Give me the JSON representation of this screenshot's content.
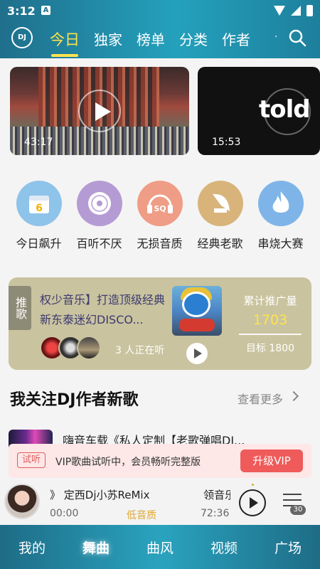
{
  "status": {
    "time": "3:12",
    "notif_glyph": "A"
  },
  "header": {
    "logo": "DJ",
    "tabs": [
      "今日",
      "独家",
      "榜单",
      "分类",
      "作者"
    ],
    "active_tab": "今日",
    "overflow": "·"
  },
  "videos": [
    {
      "duration": "43:17"
    },
    {
      "duration": "15:53",
      "text": "told"
    }
  ],
  "categories": [
    {
      "label": "今日飙升",
      "icon": "calendar-icon",
      "color": "#8ec3ea",
      "glyph": "6"
    },
    {
      "label": "百听不厌",
      "icon": "disc-icon",
      "color": "#b59bd3",
      "glyph": "◉"
    },
    {
      "label": "无损音质",
      "icon": "headphones-sq-icon",
      "color": "#ef9d86",
      "glyph": "SQ"
    },
    {
      "label": "经典老歌",
      "icon": "gramophone-icon",
      "color": "#d8b47a",
      "glyph": "♫"
    },
    {
      "label": "串烧大赛",
      "icon": "flame-icon",
      "color": "#7fb4e8",
      "glyph": "♨"
    }
  ],
  "recommend": {
    "badge": "推歌",
    "title": "权少音乐】打造顶级经典新东泰迷幻DISCO...",
    "listeners": "3 人正在听",
    "stat_label": "累计推广量",
    "stat_value": "1703",
    "target": "目标 1800"
  },
  "section": {
    "title": "我关注DJ作者新歌",
    "more": "查看更多"
  },
  "song": {
    "title": "嗨音车载《私人定制【老歌弹唱DJ..."
  },
  "trial": {
    "tag": "试听",
    "message": "VIP歌曲试听中，会员畅听完整版",
    "button": "升级VIP"
  },
  "player": {
    "title": "》 定西Dj小苏ReMix",
    "artist": "领音乐",
    "current": "00:00",
    "quality": "低音质",
    "total": "72:36",
    "queue_count": "30"
  },
  "nav": {
    "items": [
      "我的",
      "舞曲",
      "曲风",
      "视频",
      "广场"
    ],
    "active": "舞曲"
  },
  "colors": {
    "accent": "#ffe34d",
    "header_bg": "#24a1bd",
    "vip_red": "#ef5a5a",
    "quality": "#e0a72c"
  }
}
